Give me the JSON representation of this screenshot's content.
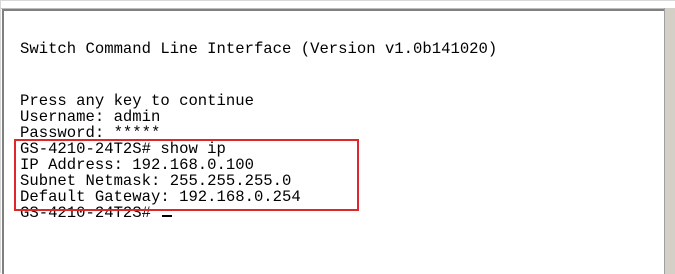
{
  "terminal": {
    "lines": [
      "Switch Command Line Interface (Version v1.0b141020)",
      "Press any key to continue",
      "Username: admin",
      "Password: *****",
      "GS-4210-24T2S# show ip",
      "IP Address: 192.168.0.100",
      "Subnet Netmask: 255.255.255.0",
      "Default Gateway: 192.168.0.254",
      "GS-4210-24T2S# "
    ],
    "highlight_color": "#e0262b"
  }
}
